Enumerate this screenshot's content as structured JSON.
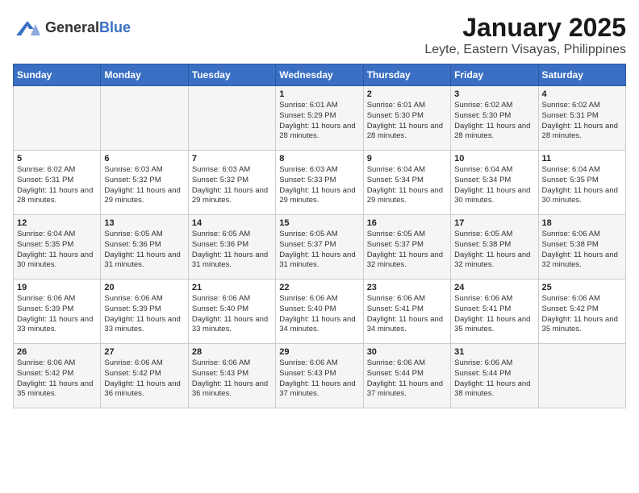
{
  "header": {
    "logo_general": "General",
    "logo_blue": "Blue",
    "month_title": "January 2025",
    "location": "Leyte, Eastern Visayas, Philippines"
  },
  "days_of_week": [
    "Sunday",
    "Monday",
    "Tuesday",
    "Wednesday",
    "Thursday",
    "Friday",
    "Saturday"
  ],
  "weeks": [
    [
      {
        "num": "",
        "sunrise": "",
        "sunset": "",
        "daylight": ""
      },
      {
        "num": "",
        "sunrise": "",
        "sunset": "",
        "daylight": ""
      },
      {
        "num": "",
        "sunrise": "",
        "sunset": "",
        "daylight": ""
      },
      {
        "num": "1",
        "sunrise": "Sunrise: 6:01 AM",
        "sunset": "Sunset: 5:29 PM",
        "daylight": "Daylight: 11 hours and 28 minutes."
      },
      {
        "num": "2",
        "sunrise": "Sunrise: 6:01 AM",
        "sunset": "Sunset: 5:30 PM",
        "daylight": "Daylight: 11 hours and 28 minutes."
      },
      {
        "num": "3",
        "sunrise": "Sunrise: 6:02 AM",
        "sunset": "Sunset: 5:30 PM",
        "daylight": "Daylight: 11 hours and 28 minutes."
      },
      {
        "num": "4",
        "sunrise": "Sunrise: 6:02 AM",
        "sunset": "Sunset: 5:31 PM",
        "daylight": "Daylight: 11 hours and 28 minutes."
      }
    ],
    [
      {
        "num": "5",
        "sunrise": "Sunrise: 6:02 AM",
        "sunset": "Sunset: 5:31 PM",
        "daylight": "Daylight: 11 hours and 28 minutes."
      },
      {
        "num": "6",
        "sunrise": "Sunrise: 6:03 AM",
        "sunset": "Sunset: 5:32 PM",
        "daylight": "Daylight: 11 hours and 29 minutes."
      },
      {
        "num": "7",
        "sunrise": "Sunrise: 6:03 AM",
        "sunset": "Sunset: 5:32 PM",
        "daylight": "Daylight: 11 hours and 29 minutes."
      },
      {
        "num": "8",
        "sunrise": "Sunrise: 6:03 AM",
        "sunset": "Sunset: 5:33 PM",
        "daylight": "Daylight: 11 hours and 29 minutes."
      },
      {
        "num": "9",
        "sunrise": "Sunrise: 6:04 AM",
        "sunset": "Sunset: 5:34 PM",
        "daylight": "Daylight: 11 hours and 29 minutes."
      },
      {
        "num": "10",
        "sunrise": "Sunrise: 6:04 AM",
        "sunset": "Sunset: 5:34 PM",
        "daylight": "Daylight: 11 hours and 30 minutes."
      },
      {
        "num": "11",
        "sunrise": "Sunrise: 6:04 AM",
        "sunset": "Sunset: 5:35 PM",
        "daylight": "Daylight: 11 hours and 30 minutes."
      }
    ],
    [
      {
        "num": "12",
        "sunrise": "Sunrise: 6:04 AM",
        "sunset": "Sunset: 5:35 PM",
        "daylight": "Daylight: 11 hours and 30 minutes."
      },
      {
        "num": "13",
        "sunrise": "Sunrise: 6:05 AM",
        "sunset": "Sunset: 5:36 PM",
        "daylight": "Daylight: 11 hours and 31 minutes."
      },
      {
        "num": "14",
        "sunrise": "Sunrise: 6:05 AM",
        "sunset": "Sunset: 5:36 PM",
        "daylight": "Daylight: 11 hours and 31 minutes."
      },
      {
        "num": "15",
        "sunrise": "Sunrise: 6:05 AM",
        "sunset": "Sunset: 5:37 PM",
        "daylight": "Daylight: 11 hours and 31 minutes."
      },
      {
        "num": "16",
        "sunrise": "Sunrise: 6:05 AM",
        "sunset": "Sunset: 5:37 PM",
        "daylight": "Daylight: 11 hours and 32 minutes."
      },
      {
        "num": "17",
        "sunrise": "Sunrise: 6:05 AM",
        "sunset": "Sunset: 5:38 PM",
        "daylight": "Daylight: 11 hours and 32 minutes."
      },
      {
        "num": "18",
        "sunrise": "Sunrise: 6:06 AM",
        "sunset": "Sunset: 5:38 PM",
        "daylight": "Daylight: 11 hours and 32 minutes."
      }
    ],
    [
      {
        "num": "19",
        "sunrise": "Sunrise: 6:06 AM",
        "sunset": "Sunset: 5:39 PM",
        "daylight": "Daylight: 11 hours and 33 minutes."
      },
      {
        "num": "20",
        "sunrise": "Sunrise: 6:06 AM",
        "sunset": "Sunset: 5:39 PM",
        "daylight": "Daylight: 11 hours and 33 minutes."
      },
      {
        "num": "21",
        "sunrise": "Sunrise: 6:06 AM",
        "sunset": "Sunset: 5:40 PM",
        "daylight": "Daylight: 11 hours and 33 minutes."
      },
      {
        "num": "22",
        "sunrise": "Sunrise: 6:06 AM",
        "sunset": "Sunset: 5:40 PM",
        "daylight": "Daylight: 11 hours and 34 minutes."
      },
      {
        "num": "23",
        "sunrise": "Sunrise: 6:06 AM",
        "sunset": "Sunset: 5:41 PM",
        "daylight": "Daylight: 11 hours and 34 minutes."
      },
      {
        "num": "24",
        "sunrise": "Sunrise: 6:06 AM",
        "sunset": "Sunset: 5:41 PM",
        "daylight": "Daylight: 11 hours and 35 minutes."
      },
      {
        "num": "25",
        "sunrise": "Sunrise: 6:06 AM",
        "sunset": "Sunset: 5:42 PM",
        "daylight": "Daylight: 11 hours and 35 minutes."
      }
    ],
    [
      {
        "num": "26",
        "sunrise": "Sunrise: 6:06 AM",
        "sunset": "Sunset: 5:42 PM",
        "daylight": "Daylight: 11 hours and 35 minutes."
      },
      {
        "num": "27",
        "sunrise": "Sunrise: 6:06 AM",
        "sunset": "Sunset: 5:42 PM",
        "daylight": "Daylight: 11 hours and 36 minutes."
      },
      {
        "num": "28",
        "sunrise": "Sunrise: 6:06 AM",
        "sunset": "Sunset: 5:43 PM",
        "daylight": "Daylight: 11 hours and 36 minutes."
      },
      {
        "num": "29",
        "sunrise": "Sunrise: 6:06 AM",
        "sunset": "Sunset: 5:43 PM",
        "daylight": "Daylight: 11 hours and 37 minutes."
      },
      {
        "num": "30",
        "sunrise": "Sunrise: 6:06 AM",
        "sunset": "Sunset: 5:44 PM",
        "daylight": "Daylight: 11 hours and 37 minutes."
      },
      {
        "num": "31",
        "sunrise": "Sunrise: 6:06 AM",
        "sunset": "Sunset: 5:44 PM",
        "daylight": "Daylight: 11 hours and 38 minutes."
      },
      {
        "num": "",
        "sunrise": "",
        "sunset": "",
        "daylight": ""
      }
    ]
  ]
}
